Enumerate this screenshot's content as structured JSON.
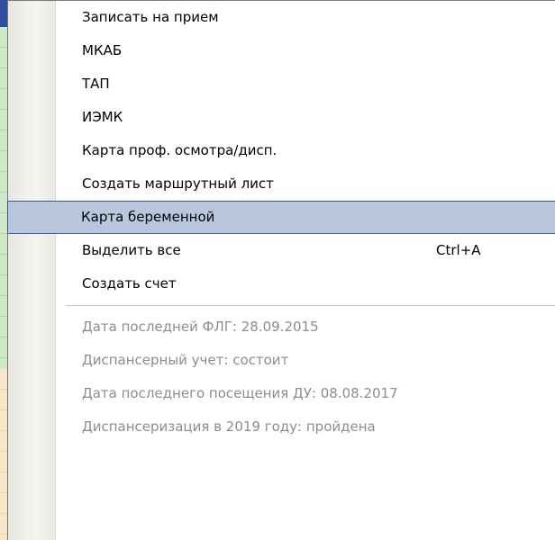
{
  "menu": {
    "items": [
      {
        "label": "Записать на прием"
      },
      {
        "label": "МКАБ"
      },
      {
        "label": "ТАП"
      },
      {
        "label": "ИЭМК"
      },
      {
        "label": "Карта проф. осмотра/дисп."
      },
      {
        "label": "Создать маршрутный лист"
      },
      {
        "label": "Карта беременной",
        "highlighted": true
      },
      {
        "label": "Выделить все",
        "shortcut": "Ctrl+A"
      },
      {
        "label": "Создать счет"
      }
    ],
    "info_items": [
      {
        "label": "Дата последней ФЛГ: 28.09.2015"
      },
      {
        "label": "Диспансерный учет: состоит"
      },
      {
        "label": "Дата последнего посещения ДУ: 08.08.2017"
      },
      {
        "label": "Диспансеризация в 2019 году: пройдена"
      }
    ]
  },
  "colors": {
    "highlight_bg": "#b9c6dd",
    "highlight_border": "#3c5a99",
    "disabled_text": "#8d8d8d"
  }
}
